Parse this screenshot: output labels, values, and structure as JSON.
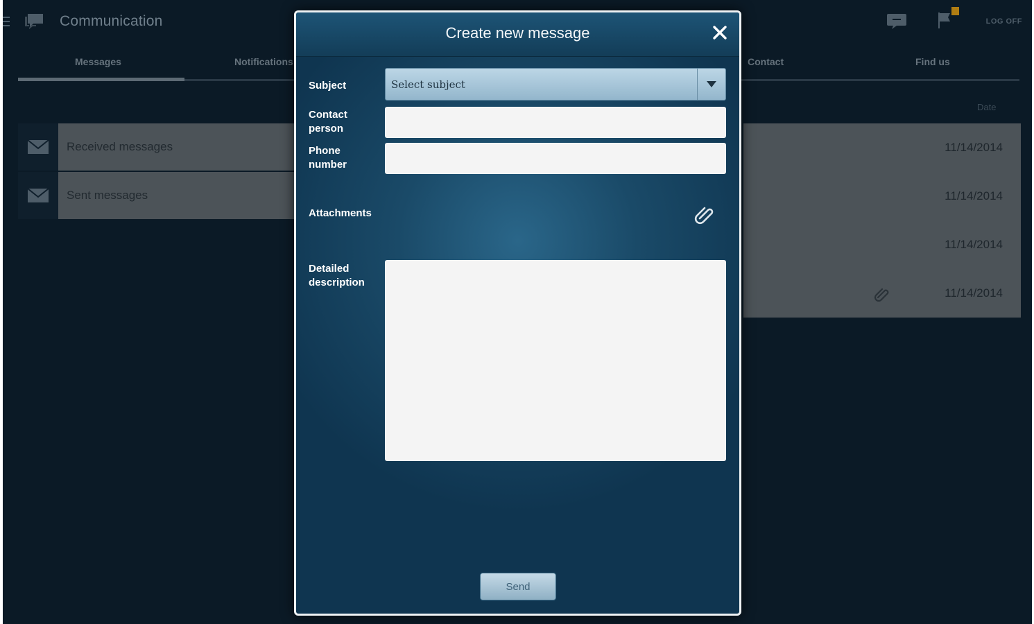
{
  "app": {
    "title": "Communication",
    "logoff_label": "LOG OFF"
  },
  "tabs": [
    {
      "label": "Messages",
      "active": true
    },
    {
      "label": "Notifications",
      "active": false
    },
    {
      "label": "Contact",
      "active": false
    },
    {
      "label": "Find us",
      "active": false
    }
  ],
  "list": {
    "date_header": "Date",
    "folders": [
      {
        "label": "Received messages",
        "icon": "envelope-icon"
      },
      {
        "label": "Sent messages",
        "icon": "envelope-icon"
      }
    ],
    "message_dates": [
      "11/14/2014",
      "11/14/2014",
      "11/14/2014",
      "11/14/2014"
    ]
  },
  "dialog": {
    "title": "Create new message",
    "subject_label": "Subject",
    "subject_value": "Select subject",
    "contact_label_line1": "Contact",
    "contact_label_line2": "person",
    "contact_value": "",
    "phone_label_line1": "Phone",
    "phone_label_line2": "number",
    "phone_value": "",
    "attachments_label": "Attachments",
    "description_label_line1": "Detailed",
    "description_label_line2": "description",
    "description_value": "",
    "send_label": "Send"
  },
  "colors": {
    "background": "#0b1a26",
    "dialog": "#1a4a68",
    "row_fill": "#4c5358",
    "badge": "#b07d12"
  }
}
